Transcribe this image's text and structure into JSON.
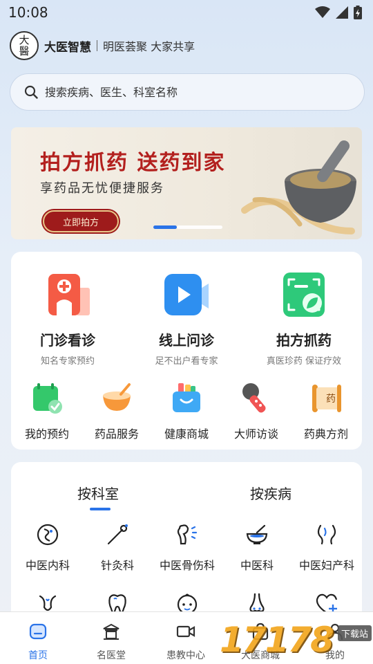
{
  "status_bar": {
    "time": "10:08"
  },
  "brand": {
    "logo_text": "大醫",
    "name": "大医智慧",
    "slogan": "明医荟聚 大家共享"
  },
  "search": {
    "placeholder": "搜索疾病、医生、科室名称"
  },
  "banner": {
    "title": "拍方抓药 送药到家",
    "subtitle": "享药品无忧便捷服务",
    "button": "立即拍方",
    "active_slide": 1,
    "slide_count": 2
  },
  "services": {
    "main": [
      {
        "title": "门诊看诊",
        "subtitle": "知名专家预约",
        "icon": "hospital-icon"
      },
      {
        "title": "线上问诊",
        "subtitle": "足不出户看专家",
        "icon": "video-icon"
      },
      {
        "title": "拍方抓药",
        "subtitle": "真医珍药 保证疗效",
        "icon": "scan-leaf-icon"
      }
    ],
    "secondary": [
      {
        "label": "我的预约",
        "icon": "calendar-check-icon"
      },
      {
        "label": "药品服务",
        "icon": "medicine-bowl-icon"
      },
      {
        "label": "健康商城",
        "icon": "shopping-bag-icon"
      },
      {
        "label": "大师访谈",
        "icon": "microphone-icon"
      },
      {
        "label": "药典方剂",
        "icon": "scroll-icon",
        "badge": "药"
      }
    ]
  },
  "departments": {
    "tabs": [
      {
        "label": "按科室",
        "active": true
      },
      {
        "label": "按疾病",
        "active": false
      }
    ],
    "items": [
      {
        "label": "中医内科",
        "icon": "stomach-icon"
      },
      {
        "label": "针灸科",
        "icon": "needle-icon"
      },
      {
        "label": "中医骨伤科",
        "icon": "bone-icon"
      },
      {
        "label": "中医科",
        "icon": "mortar-icon"
      },
      {
        "label": "中医妇产科",
        "icon": "uterus-icon"
      }
    ],
    "row2_icons": [
      "lungs-icon",
      "tooth-icon",
      "baby-face-icon",
      "nose-icon",
      "heart-plus-icon"
    ]
  },
  "bottom_nav": [
    {
      "label": "首页",
      "icon": "home-icon",
      "active": true
    },
    {
      "label": "名医堂",
      "icon": "hall-icon",
      "active": false
    },
    {
      "label": "患教中心",
      "icon": "camera-icon",
      "active": false
    },
    {
      "label": "大医商城",
      "icon": "bag-icon",
      "active": false
    },
    {
      "label": "我的",
      "icon": "user-icon",
      "active": false
    }
  ],
  "watermark": {
    "text": "17178",
    "badge": "下载站"
  },
  "colors": {
    "accent": "#2a73e8",
    "banner_red": "#b3201e"
  }
}
